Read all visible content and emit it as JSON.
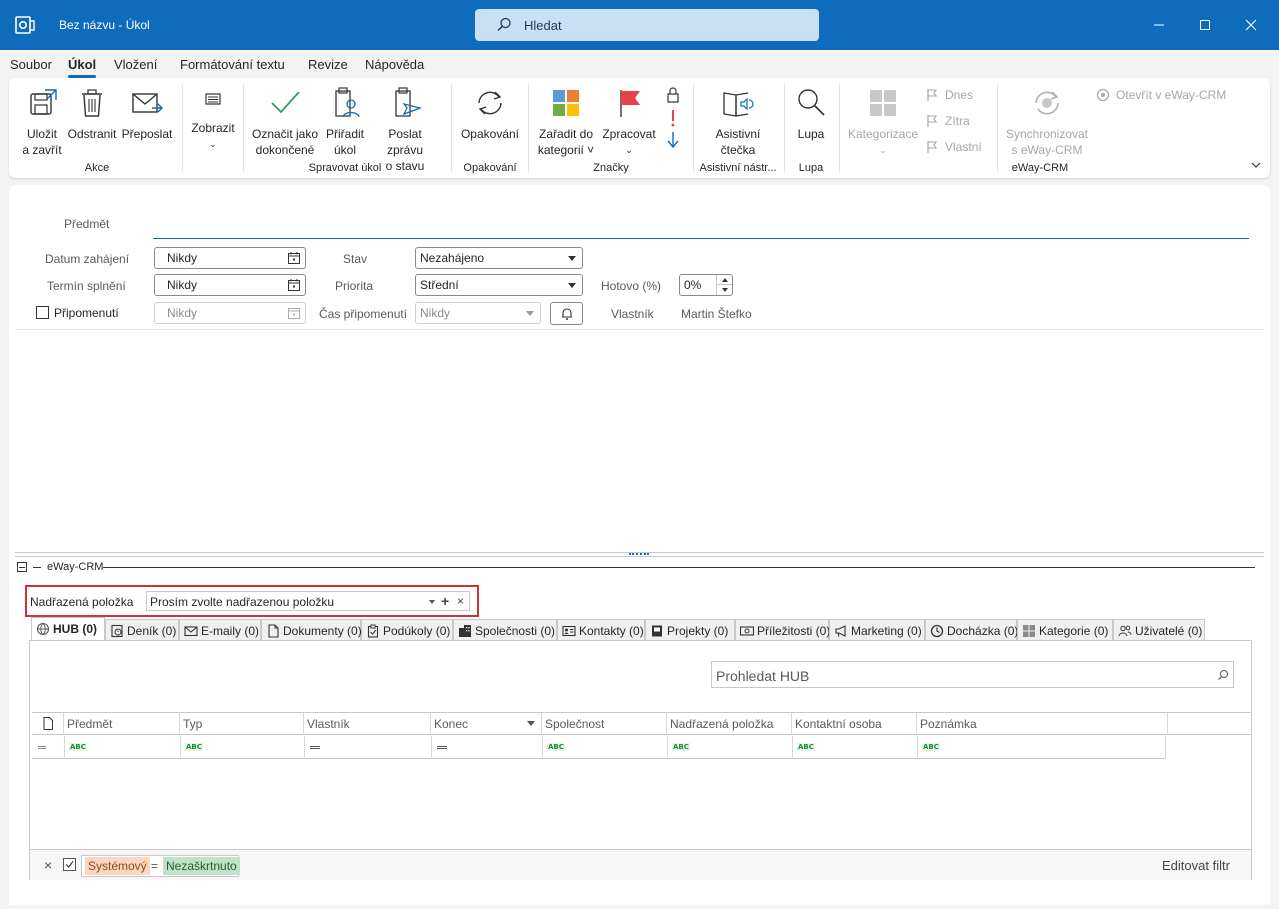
{
  "window": {
    "title": "Bez názvu  -  Úkol",
    "search_placeholder": "Hledat"
  },
  "menu": [
    "Soubor",
    "Úkol",
    "Vložení",
    "Formátování textu",
    "Revize",
    "Nápověda"
  ],
  "ribbon": {
    "akce": {
      "label": "Akce",
      "save": [
        "Uložit",
        "a zavřít"
      ],
      "delete": "Odstranit",
      "forward": "Přeposlat"
    },
    "zobrazit": {
      "label": "Zobrazit"
    },
    "spravovat": {
      "label": "Spravovat úkol",
      "mark": [
        "Označit jako",
        "dokončené"
      ],
      "assign": [
        "Přiřadit",
        "úkol"
      ],
      "send": [
        "Poslat zprávu",
        "o stavu"
      ]
    },
    "opakovani": {
      "label": "Opakování",
      "btn": "Opakování"
    },
    "znacky": {
      "label": "Značky",
      "categorize": [
        "Zařadit do",
        "kategorií"
      ],
      "followup": "Zpracovat"
    },
    "asistivni": {
      "label": "Asistivní nástr...",
      "reader": [
        "Asistivní",
        "čtečka"
      ]
    },
    "lupa": {
      "label": "Lupa",
      "btn": "Lupa"
    },
    "eway": {
      "label": "eWay-CRM",
      "categorize": "Kategorizace",
      "today": "Dnes",
      "tomorrow": "Zítra",
      "custom": "Vlastní",
      "sync": [
        "Synchronizovat",
        "s eWay-CRM"
      ],
      "open": "Otevřít v eWay-CRM"
    }
  },
  "form": {
    "subject_label": "Předmět",
    "start_label": "Datum zahájení",
    "start_value": "Nikdy",
    "due_label": "Termín splnění",
    "due_value": "Nikdy",
    "reminder_label": "Připomenutí",
    "reminder_value": "Nikdy",
    "status_label": "Stav",
    "status_value": "Nezahájeno",
    "priority_label": "Priorita",
    "priority_value": "Střední",
    "reminder_time_label": "Čas připomenutí",
    "reminder_time_value": "Nikdy",
    "done_label": "Hotovo (%)",
    "done_value": "0%",
    "owner_label": "Vlastník",
    "owner_value": "Martin Štefko"
  },
  "eway": {
    "section_title": "eWay-CRM",
    "parent_label": "Nadřazená položka",
    "parent_placeholder": "Prosím zvolte nadřazenou položku",
    "tabs": [
      "HUB (0)",
      "Deník (0)",
      "E-maily (0)",
      "Dokumenty (0)",
      "Podúkoly (0)",
      "Společnosti (0)",
      "Kontakty (0)",
      "Projekty (0)",
      "Příležitosti (0)",
      "Marketing (0)",
      "Docházka (0)",
      "Kategorie (0)",
      "Uživatelé (0)"
    ],
    "hub_search_placeholder": "Prohledat HUB",
    "columns": [
      "Předmět",
      "Typ",
      "Vlastník",
      "Konec",
      "Společnost",
      "Nadřazená položka",
      "Kontaktní osoba",
      "Poznámka"
    ],
    "filter_tag1": "Systémový",
    "filter_eq": "=",
    "filter_tag2": "Nezaškrtnuto",
    "edit_filter": "Editovat filtr"
  },
  "colors": {
    "accent": "#0f6cbd",
    "highlight_border": "#d13438"
  }
}
